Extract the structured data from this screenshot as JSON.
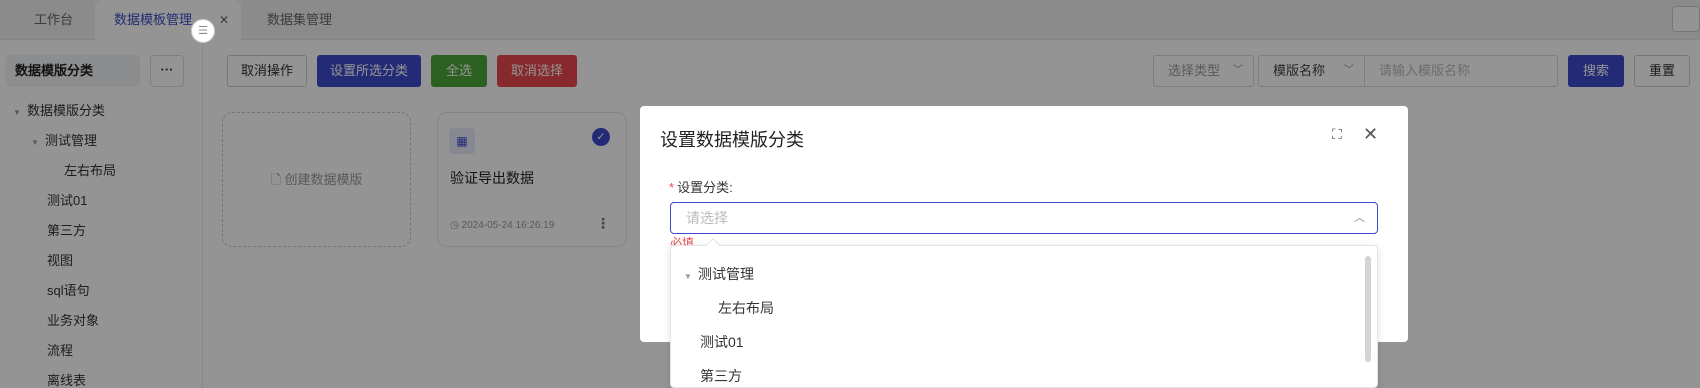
{
  "tabs": [
    {
      "label": "工作台"
    },
    {
      "label": "数据模板管理",
      "active": true
    },
    {
      "label": "数据集管理"
    }
  ],
  "sidebar": {
    "header": "数据模版分类",
    "more_label": "···",
    "tree": [
      {
        "label": "数据模版分类",
        "level": 0,
        "expanded": true
      },
      {
        "label": "测试管理",
        "level": 1,
        "expanded": true
      },
      {
        "label": "左右布局",
        "level": 2
      },
      {
        "label": "测试01",
        "level": 1
      },
      {
        "label": "第三方",
        "level": 1
      },
      {
        "label": "视图",
        "level": 1
      },
      {
        "label": "sql语句",
        "level": 1
      },
      {
        "label": "业务对象",
        "level": 1
      },
      {
        "label": "流程",
        "level": 1
      },
      {
        "label": "离线表",
        "level": 1
      }
    ]
  },
  "toolbar": {
    "cancel_op": "取消操作",
    "set_category": "设置所选分类",
    "select_all": "全选",
    "cancel_select": "取消选择",
    "type_select": "选择类型",
    "field_select": "模版名称",
    "search_placeholder": "请输入模版名称",
    "search": "搜索",
    "reset": "重置"
  },
  "cards": {
    "create_label": "创建数据模版",
    "items": [
      {
        "title": "验证导出数据",
        "time": "2024-05-24 16:26:19",
        "checked": true
      }
    ]
  },
  "modal": {
    "title": "设置数据模版分类",
    "field_label": "设置分类:",
    "placeholder": "请选择",
    "error": "必填",
    "options": [
      {
        "label": "测试管理",
        "level": 0,
        "expanded": true
      },
      {
        "label": "左右布局",
        "level": 1
      },
      {
        "label": "测试01",
        "level": 0
      },
      {
        "label": "第三方",
        "level": 0
      }
    ]
  },
  "colors": {
    "primary": "#3e4bcc",
    "success": "#4aa53a",
    "danger": "#e8484f"
  }
}
